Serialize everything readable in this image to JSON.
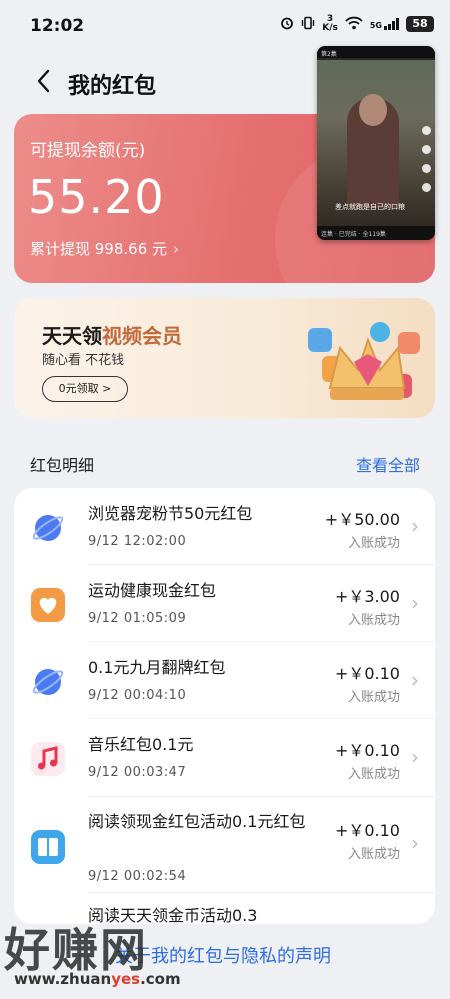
{
  "status_bar": {
    "time": "12:02",
    "net_speed_top": "3",
    "net_speed_bottom": "K/s",
    "network": "5G",
    "battery": "58",
    "icons": [
      "alarm-icon",
      "vibrate-icon",
      "net-speed-icon",
      "wifi-icon",
      "signal-icon",
      "battery-icon"
    ]
  },
  "header": {
    "title": "我的红包"
  },
  "balance": {
    "label": "可提现余额(元)",
    "amount": "55.20",
    "total_withdrawn": "累计提现 998.66 元",
    "colors": {
      "card": "#e56f6f"
    }
  },
  "floating_video": {
    "top_text": "第2集",
    "subtitle": "差点就跑是自己的口粮",
    "bottom_text": "连集 · 已完结 · 全119集"
  },
  "vip_banner": {
    "title_prefix": "天天领",
    "title_highlight": "视频会员",
    "subtitle": "随心看 不花钱",
    "button_label": "0元领取",
    "colors": {
      "highlight": "#c06a3b"
    }
  },
  "records": {
    "title": "红包明细",
    "view_all": "查看全部",
    "items": [
      {
        "title": "浏览器宠粉节50元红包",
        "time": "9/12 12:02:00",
        "amount": "+￥50.00",
        "status": "入账成功",
        "icon": "browser-icon"
      },
      {
        "title": "运动健康现金红包",
        "time": "9/12 01:05:09",
        "amount": "+￥3.00",
        "status": "入账成功",
        "icon": "health-icon"
      },
      {
        "title": "0.1元九月翻牌红包",
        "time": "9/12 00:04:10",
        "amount": "+￥0.10",
        "status": "入账成功",
        "icon": "browser-icon"
      },
      {
        "title": "音乐红包0.1元",
        "time": "9/12 00:03:47",
        "amount": "+￥0.10",
        "status": "入账成功",
        "icon": "music-icon"
      },
      {
        "title": "阅读领现金红包活动0.1元红包",
        "time": "9/12 00:02:54",
        "amount": "+￥0.10",
        "status": "入账成功",
        "icon": "book-icon"
      },
      {
        "title": "阅读天天领金币活动0.3",
        "time": "",
        "amount": "",
        "status": "",
        "icon": "book-icon"
      }
    ]
  },
  "footer": {
    "link": "关于我的红包与隐私的声明"
  },
  "watermark": {
    "big": "好赚网",
    "small_prefix": "www.zhuan",
    "small_red": "yes",
    "small_suffix": ".com"
  },
  "colors": {
    "accent_blue": "#2d6ee0",
    "background": "#eef0f4"
  }
}
